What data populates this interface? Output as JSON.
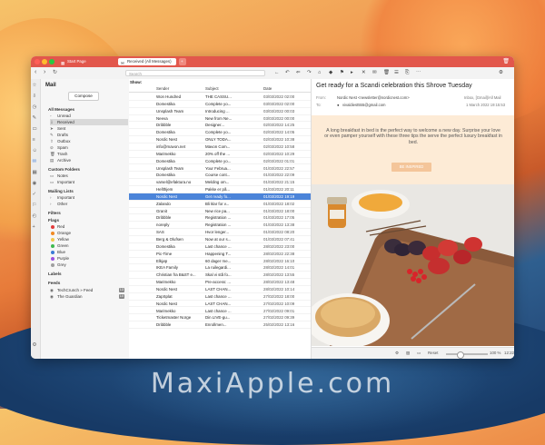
{
  "window": {
    "tabs": [
      {
        "label": "Start Page",
        "icon": "calendar-icon"
      },
      {
        "label": "Received (All Messages)",
        "icon": "mail-icon"
      }
    ],
    "new_tab_symbol": "+",
    "search_placeholder": "Search"
  },
  "sidebar": {
    "title": "Mail",
    "compose_label": "Compose",
    "all_messages_label": "All Messages",
    "folders": [
      {
        "label": "Unread"
      },
      {
        "label": "Received",
        "selected": true
      },
      {
        "label": "Sent"
      },
      {
        "label": "Drafts"
      },
      {
        "label": "Outbox"
      },
      {
        "label": "Spam"
      },
      {
        "label": "Trash"
      },
      {
        "label": "Archive"
      }
    ],
    "custom_folders_label": "Custom Folders",
    "custom_folders": [
      {
        "label": "Notes"
      },
      {
        "label": "Important"
      }
    ],
    "mailing_lists_label": "Mailing Lists",
    "mailing_lists": [
      {
        "label": "Important"
      },
      {
        "label": "Other"
      }
    ],
    "filters_label": "Filters",
    "flags_label": "Flags",
    "flags": [
      {
        "label": "Red",
        "color": "#e23b3b"
      },
      {
        "label": "Orange",
        "color": "#f08a24"
      },
      {
        "label": "Yellow",
        "color": "#f2c94c"
      },
      {
        "label": "Green",
        "color": "#3fb950"
      },
      {
        "label": "Blue",
        "color": "#3a7bd5"
      },
      {
        "label": "Purple",
        "color": "#9b51e0"
      },
      {
        "label": "Grey",
        "color": "#9e9e9e"
      }
    ],
    "labels_label": "Labels",
    "feeds_label": "Feeds",
    "feeds": [
      {
        "label": "TechCrunch » Feed",
        "count": "13"
      },
      {
        "label": "The Guardian",
        "count": "10"
      }
    ]
  },
  "list": {
    "show_label": "Show:",
    "columns": {
      "sender": "Sender",
      "subject": "Subject",
      "date": "Date"
    },
    "rows": [
      {
        "sender": "Won Hundred",
        "subject": "THE CASSU...",
        "date": "03/03/2022 02:00"
      },
      {
        "sender": "Domestika",
        "subject": "Complete yo...",
        "date": "03/03/2022 02:00"
      },
      {
        "sender": "Unsplash Team",
        "subject": "Introducing ...",
        "date": "03/03/2022 00:03"
      },
      {
        "sender": "Neeva",
        "subject": "New from Ne...",
        "date": "03/03/2022 00:00"
      },
      {
        "sender": "Dribbble",
        "subject": "Designer...",
        "date": "02/03/2022 14:25"
      },
      {
        "sender": "Domestika",
        "subject": "Complete yo...",
        "date": "02/03/2022 14:05"
      },
      {
        "sender": "Nordic Nest",
        "subject": "ONLY TODA...",
        "date": "02/03/2022 10:38"
      },
      {
        "sender": "info@mavon.net",
        "subject": "Mavon Com...",
        "date": "02/03/2022 10:58"
      },
      {
        "sender": "Marimekko",
        "subject": "20% off the ...",
        "date": "02/03/2022 10:29"
      },
      {
        "sender": "Domestika",
        "subject": "Complete yo...",
        "date": "02/03/2022 01:01"
      },
      {
        "sender": "Unsplash Team",
        "subject": "Your Februa...",
        "date": "01/03/2022 22:57"
      },
      {
        "sender": "Domestika",
        "subject": "Course cont...",
        "date": "01/03/2022 22:09"
      },
      {
        "sender": "varsel@efaktura.no",
        "subject": "Melding om...",
        "date": "01/03/2022 21:15"
      },
      {
        "sender": "Hellthjem",
        "subject": "Pakke er på...",
        "date": "01/03/2022 20:11"
      },
      {
        "sender": "Nordic Nest",
        "subject": "Get ready fo...",
        "date": "01/03/2022 19:19",
        "selected": true
      },
      {
        "sender": "Zalando",
        "subject": "Bli klar for v...",
        "date": "01/03/2022 18:02"
      },
      {
        "sender": "Granit",
        "subject": "New rice pa...",
        "date": "01/03/2022 18:00"
      },
      {
        "sender": "Dribbble",
        "subject": "Registration ...",
        "date": "01/03/2022 17:05"
      },
      {
        "sender": "noreply",
        "subject": "Registration ...",
        "date": "01/03/2022 13:38"
      },
      {
        "sender": "SAS",
        "subject": "Hvor lenger...",
        "date": "01/03/2022 08:20"
      },
      {
        "sender": "Berg & Olufsen",
        "subject": "Now at our s...",
        "date": "01/03/2022 07:41"
      },
      {
        "sender": "Domestika",
        "subject": "Last chance ...",
        "date": "28/02/2022 23:00"
      },
      {
        "sender": "Pic-Time",
        "subject": "Happening T...",
        "date": "28/02/2022 22:38"
      },
      {
        "sender": "Elkjøp",
        "subject": "60 dager me...",
        "date": "28/02/2022 16:10"
      },
      {
        "sender": "IKEA Family",
        "subject": "La ruilegardi...",
        "date": "28/02/2022 14:01"
      },
      {
        "sender": "Christian fra B&ST e...",
        "subject": "Skal vi stå fo...",
        "date": "28/02/2022 13:55"
      },
      {
        "sender": "Marimekko",
        "subject": "Pre-access: ...",
        "date": "28/02/2022 13:48"
      },
      {
        "sender": "Nordic Nest",
        "subject": "LAST CHAN...",
        "date": "28/02/2022 10:14"
      },
      {
        "sender": "ZapSplat",
        "subject": "Last chance ...",
        "date": "27/02/2022 18:00"
      },
      {
        "sender": "Nordic Nest",
        "subject": "LAST CHAN...",
        "date": "27/02/2022 10:09"
      },
      {
        "sender": "Marimekko",
        "subject": "Last chance ...",
        "date": "27/02/2022 09:01"
      },
      {
        "sender": "Ticketmaster Norge",
        "subject": "Din LIVE-gu...",
        "date": "27/02/2022 09:39"
      },
      {
        "sender": "Dribbble",
        "subject": "Enrollmen...",
        "date": "25/02/2022 13:16"
      }
    ]
  },
  "preview": {
    "subject": "Get ready for a Scandi celebration this Shrove Tuesday",
    "from_label": "From:",
    "from": "Nordic Nest <newsletter@nordicnest.com>",
    "to_label": "To:",
    "to": "vivaldiest555@gmail.com",
    "folder": "Inbox, [Gmail]/All Mail",
    "date": "1 March 2022 19:15:53",
    "body_text": "A long breakfast in bed is the perfect way to welcome a new day. Surprise your love or even pamper yourself with these three tips the serve the perfect luxury breakfast in bed.",
    "cta_label": "BE INSPIRED",
    "status_reset": "Reset",
    "status_zoom": "100 %",
    "status_time": "12:22"
  },
  "watermark": "MaxiApple.com"
}
